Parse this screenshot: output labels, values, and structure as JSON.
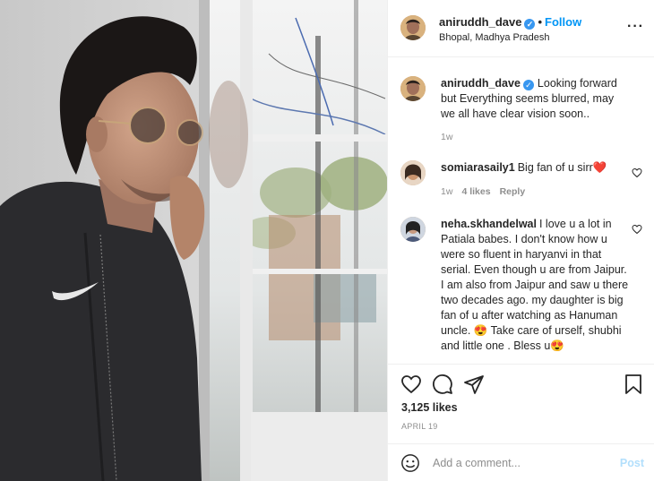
{
  "post": {
    "username": "aniruddh_dave",
    "verified_icon": "verified-badge-icon",
    "follow_separator": "•",
    "follow_label": "Follow",
    "location": "Bhopal, Madhya Pradesh",
    "more_icon": "more-options-icon",
    "caption": {
      "username": "aniruddh_dave",
      "text": "Looking forward but Everything seems blurred, may we all have clear vision soon..",
      "time": "1w"
    },
    "likes": "3,125 likes",
    "date": "APRIL 19"
  },
  "comments": [
    {
      "username": "somiarasaily1",
      "text": "Big fan of u sirr❤️",
      "time": "1w",
      "likes": "4 likes",
      "reply_label": "Reply"
    },
    {
      "username": "neha.skhandelwal",
      "text": "I love u a lot in Patiala babes. I don't know how u were so fluent in haryanvi in that serial. Even though u are from Jaipur. I am also from Jaipur and saw u there two decades ago. my daughter is big fan of u after watching as Hanuman uncle. 😍 Take care of urself, shubhi and little one . Bless u😍"
    }
  ],
  "composer": {
    "placeholder": "Add a comment...",
    "post_label": "Post"
  },
  "colors": {
    "accent": "#0095f6",
    "post_disabled": "#b2dffc",
    "muted": "#8e8e8e",
    "heart": "#ed4956"
  }
}
